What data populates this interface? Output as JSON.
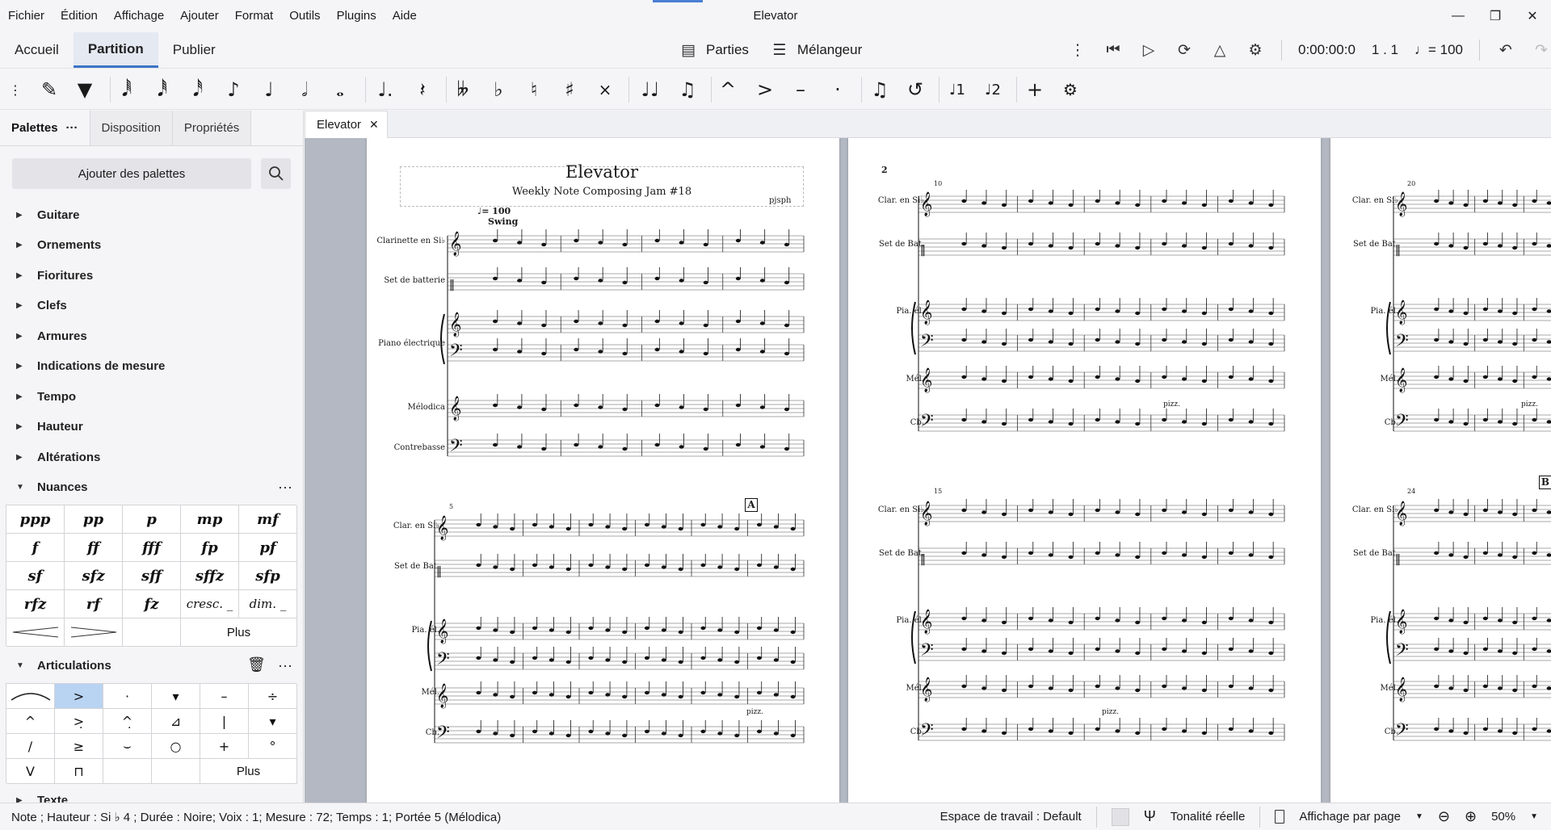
{
  "window": {
    "title": "Elevator"
  },
  "menu": [
    "Fichier",
    "Édition",
    "Affichage",
    "Ajouter",
    "Format",
    "Outils",
    "Plugins",
    "Aide"
  ],
  "tabs": {
    "home": "Accueil",
    "score": "Partition",
    "publish": "Publier"
  },
  "toolbar": {
    "parts": "Parties",
    "mixer": "Mélangeur",
    "time": "0:00:00:0",
    "position": "1 . 1",
    "tempo": "= 100"
  },
  "panel": {
    "tabs": [
      "Palettes",
      "Disposition",
      "Propriétés"
    ],
    "add_palettes": "Ajouter des palettes",
    "sections": [
      "Guitare",
      "Ornements",
      "Fioritures",
      "Clefs",
      "Armures",
      "Indications de mesure",
      "Tempo",
      "Hauteur",
      "Altérations",
      "Nuances",
      "Articulations",
      "Texte"
    ],
    "dynamics": [
      "ppp",
      "pp",
      "p",
      "mp",
      "mf",
      "f",
      "ff",
      "fff",
      "fp",
      "pf",
      "sf",
      "sfz",
      "sff",
      "sffz",
      "sfp",
      "rfz",
      "rf",
      "fz",
      "cresc. _",
      "dim. _"
    ],
    "more": "Plus"
  },
  "document": {
    "tab": "Elevator"
  },
  "score": {
    "title": "Elevator",
    "subtitle": "Weekly Note Composing Jam #18",
    "composer": "pjsph",
    "tempo_mark": "= 100",
    "style_mark": "Swing",
    "rehearsal": "A",
    "rehearsal2": "B",
    "pizz": "pizz.",
    "page2_number": "2",
    "instruments_full": [
      "Clarinette en Si♭",
      "Set de batterie",
      "Piano électrique",
      "Mélodica",
      "Contrebasse"
    ],
    "instruments_short": [
      "Clar. en Si♭",
      "Set de Bat.",
      "Pia. él.",
      "Mél.",
      "Cb."
    ],
    "measure_numbers": [
      "5",
      "10",
      "15",
      "20",
      "24"
    ]
  },
  "status": {
    "selection": "Note ; Hauteur : Si ♭ 4 ; Durée : Noire; Voix : 1; Mesure : 72; Temps : 1; Portée 5 (Mélodica)",
    "workspace": "Espace de travail : Default",
    "concert_pitch": "Tonalité réelle",
    "view_mode": "Affichage par page",
    "zoom": "50%"
  }
}
